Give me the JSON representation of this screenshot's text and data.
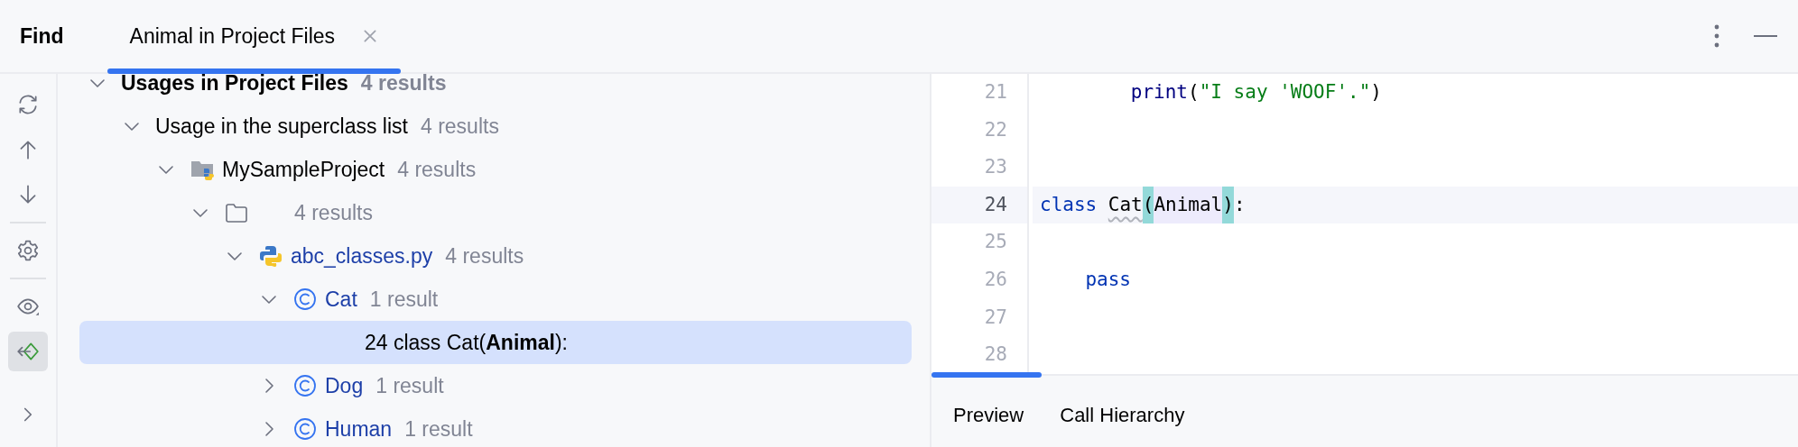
{
  "header": {
    "title": "Find",
    "tabs": [
      {
        "label": "Animal in Project Files",
        "selected": true,
        "closable": true
      }
    ]
  },
  "toolbar": {
    "tools": [
      {
        "kind": "refresh",
        "active": false
      },
      {
        "kind": "up",
        "active": false
      },
      {
        "kind": "down",
        "active": false
      },
      {
        "kind": "divider"
      },
      {
        "kind": "settings",
        "active": false
      },
      {
        "kind": "divider"
      },
      {
        "kind": "preview",
        "active": false
      },
      {
        "kind": "navigate",
        "active": true
      },
      {
        "kind": "expand",
        "active": false
      }
    ]
  },
  "tree": [
    {
      "kind": "root",
      "label": "Usages in Project Files",
      "count": "4 results",
      "expanded": true,
      "selected": false,
      "children": [
        {
          "kind": "group",
          "label": "Usage in the superclass list",
          "count": "4 results",
          "expanded": true,
          "selected": false,
          "children": [
            {
              "kind": "project",
              "label": "MySampleProject",
              "count": "4 results",
              "expanded": true,
              "selected": false,
              "children": [
                {
                  "kind": "folder",
                  "count": "4 results",
                  "expanded": true,
                  "selected": false,
                  "children": [
                    {
                      "kind": "python-file",
                      "label": "abc_classes.py",
                      "count": "4 results",
                      "expanded": true,
                      "selected": false,
                      "children": [
                        {
                          "kind": "class",
                          "label": "Cat",
                          "count": "1 result",
                          "expanded": true,
                          "selected": false,
                          "children": [
                            {
                              "kind": "usage",
                              "label": "24 class Cat(**Animal**):",
                              "selected": true
                            }
                          ]
                        },
                        {
                          "kind": "class",
                          "label": "Dog",
                          "count": "1 result",
                          "expanded": false,
                          "selected": false
                        },
                        {
                          "kind": "class",
                          "label": "Human",
                          "count": "1 result",
                          "expanded": false,
                          "selected": false
                        }
                      ]
                    }
                  ]
                }
              ]
            }
          ]
        }
      ]
    }
  ],
  "editor": {
    "lines": [
      {
        "number": "21",
        "current": false,
        "kind": "nested",
        "tokens": [
          {
            "kind": "builtin",
            "text": "print"
          },
          {
            "kind": "plain",
            "text": "("
          },
          {
            "kind": "string",
            "text": "\"I say 'WOOF'.\""
          },
          {
            "kind": "plain",
            "text": ")"
          }
        ]
      },
      {
        "number": "22",
        "current": false
      },
      {
        "number": "23",
        "current": false
      },
      {
        "number": "24",
        "current": true,
        "kind": "top",
        "tokens": [
          {
            "kind": "keyword",
            "text": "class"
          },
          {
            "kind": "warning",
            "text": "Cat"
          },
          {
            "kind": "brace-match",
            "text": "("
          },
          {
            "kind": "usage",
            "text": "Animal"
          },
          {
            "kind": "brace-match",
            "text": ")"
          },
          {
            "kind": "plain",
            "text": ":"
          }
        ]
      },
      {
        "number": "25",
        "current": false
      },
      {
        "number": "26",
        "current": false,
        "kind": "body",
        "tokens": [
          {
            "kind": "keyword",
            "text": "pass"
          }
        ]
      },
      {
        "number": "27",
        "current": false
      },
      {
        "number": "28",
        "current": false
      }
    ]
  },
  "bottom_tabs": [
    {
      "label": "Preview",
      "selected": true
    },
    {
      "label": "Call Hierarchy",
      "selected": false
    }
  ]
}
